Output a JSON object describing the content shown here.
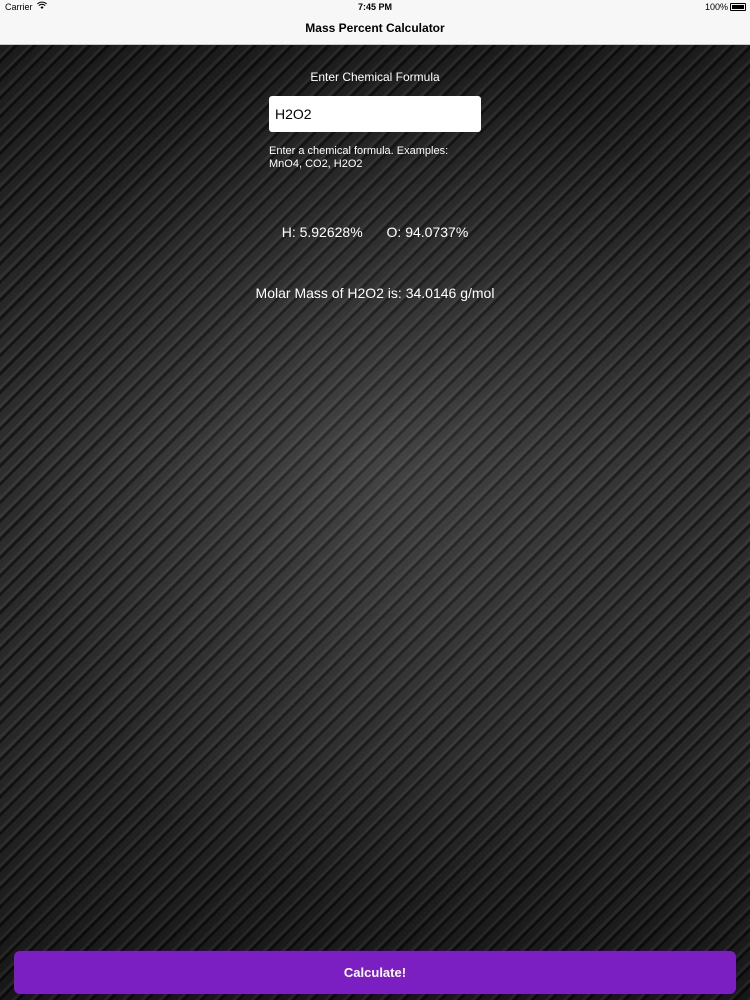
{
  "status_bar": {
    "carrier": "Carrier",
    "time": "7:45 PM",
    "battery": "100%"
  },
  "nav": {
    "title": "Mass Percent Calculator"
  },
  "form": {
    "label": "Enter Chemical Formula",
    "input_value": "H2O2",
    "hint_line1": "Enter a chemical formula. Examples:",
    "hint_line2": "MnO4, CO2, H2O2"
  },
  "results": {
    "h_percent": "H: 5.92628%",
    "o_percent": "O: 94.0737%",
    "molar_mass": "Molar Mass of H2O2 is: 34.0146 g/mol"
  },
  "actions": {
    "calculate_label": "Calculate!",
    "calculate_color": "#7b1fc2"
  }
}
